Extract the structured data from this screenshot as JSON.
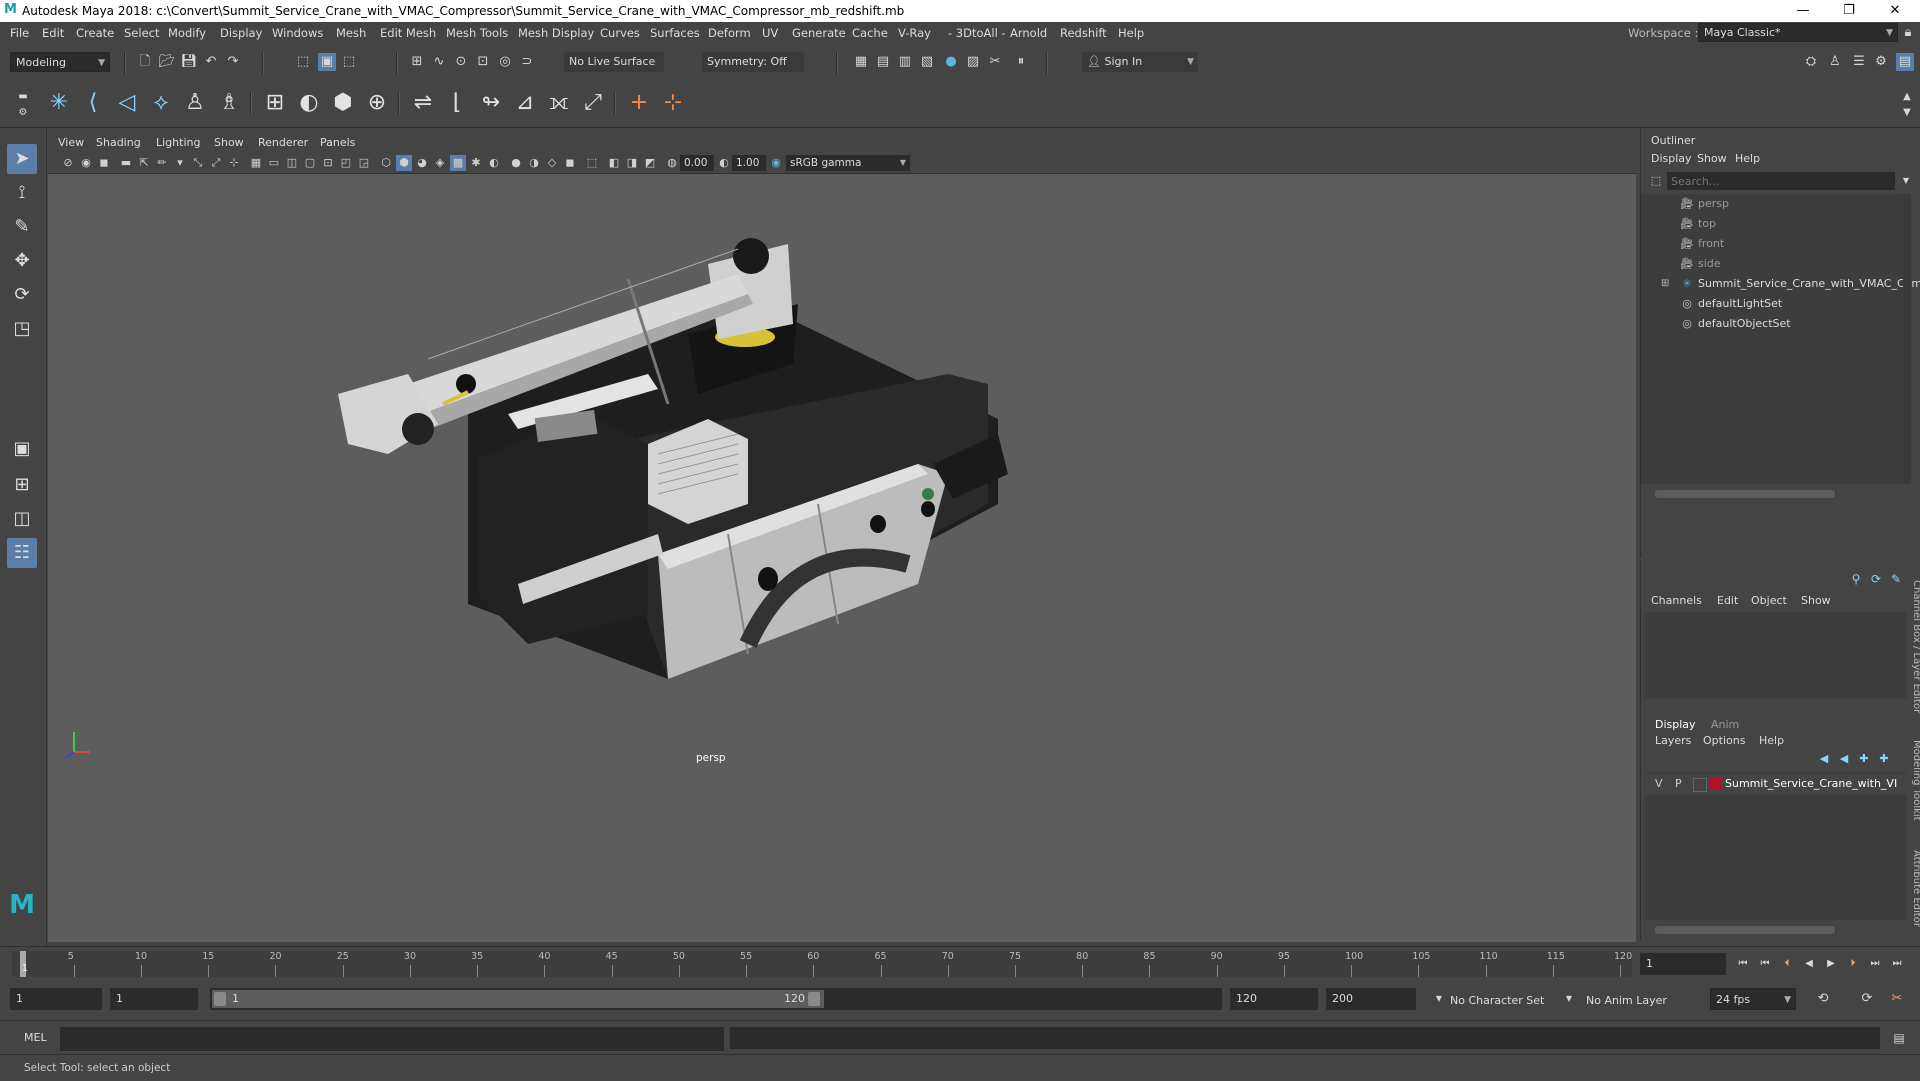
{
  "window": {
    "title": "Autodesk Maya 2018: c:\\Convert\\Summit_Service_Crane_with_VMAC_Compressor\\Summit_Service_Crane_with_VMAC_Compressor_mb_redshift.mb",
    "minimize": "—",
    "maximize": "❐",
    "close": "✕"
  },
  "menu": {
    "items": [
      "File",
      "Edit",
      "Create",
      "Select",
      "Modify",
      "Display",
      "Windows",
      "Mesh",
      "Edit Mesh",
      "Mesh Tools",
      "Mesh Display",
      "Curves",
      "Surfaces",
      "Deform",
      "UV",
      "Generate",
      "Cache",
      "V-Ray",
      "- 3DtoAll -",
      "Arnold",
      "Redshift",
      "Help"
    ],
    "workspace_label": "Workspace :",
    "workspace_value": "Maya Classic*"
  },
  "statusline": {
    "mode": "Modeling",
    "live_surface": "No Live Surface",
    "symmetry": "Symmetry: Off",
    "sign_in": "Sign In"
  },
  "viewport": {
    "menus": [
      "View",
      "Shading",
      "Lighting",
      "Show",
      "Renderer",
      "Panels"
    ],
    "exposure": "0.00",
    "gamma": "1.00",
    "color_space": "sRGB gamma",
    "camera_label": "persp"
  },
  "outliner": {
    "title": "Outliner",
    "menus": [
      "Display",
      "Show",
      "Help"
    ],
    "search_placeholder": "Search...",
    "items": [
      {
        "label": "persp",
        "dim": true
      },
      {
        "label": "top",
        "dim": true
      },
      {
        "label": "front",
        "dim": true
      },
      {
        "label": "side",
        "dim": true
      },
      {
        "label": "Summit_Service_Crane_with_VMAC_Com",
        "dim": false
      },
      {
        "label": "defaultLightSet",
        "dim": false
      },
      {
        "label": "defaultObjectSet",
        "dim": false
      }
    ]
  },
  "channelbox": {
    "menus": [
      "Channels",
      "Edit",
      "Object",
      "Show"
    ],
    "side_tabs": [
      "Channel Box / Layer Editor",
      "Modeling Toolkit",
      "Attribute Editor"
    ]
  },
  "layers": {
    "tabs": [
      "Display",
      "Anim"
    ],
    "menus": [
      "Layers",
      "Options",
      "Help"
    ],
    "layer": {
      "v": "V",
      "p": "P",
      "name": "Summit_Service_Crane_with_VI",
      "color": "#b0102a"
    }
  },
  "timeline": {
    "ticks": [
      "5",
      "10",
      "15",
      "20",
      "25",
      "30",
      "35",
      "40",
      "45",
      "50",
      "55",
      "60",
      "65",
      "70",
      "75",
      "80",
      "85",
      "90",
      "95",
      "100",
      "105",
      "110",
      "115",
      "120"
    ],
    "first_tick": "1",
    "current_frame": "1"
  },
  "range": {
    "start": "1",
    "playback_start": "1",
    "slider_start": "1",
    "slider_end": "120",
    "playback_end": "120",
    "end": "200",
    "character_set": "No Character Set",
    "anim_layer": "No Anim Layer",
    "fps": "24 fps"
  },
  "cmdline": {
    "label": "MEL"
  },
  "helpline": {
    "text": "Select Tool: select an object"
  }
}
